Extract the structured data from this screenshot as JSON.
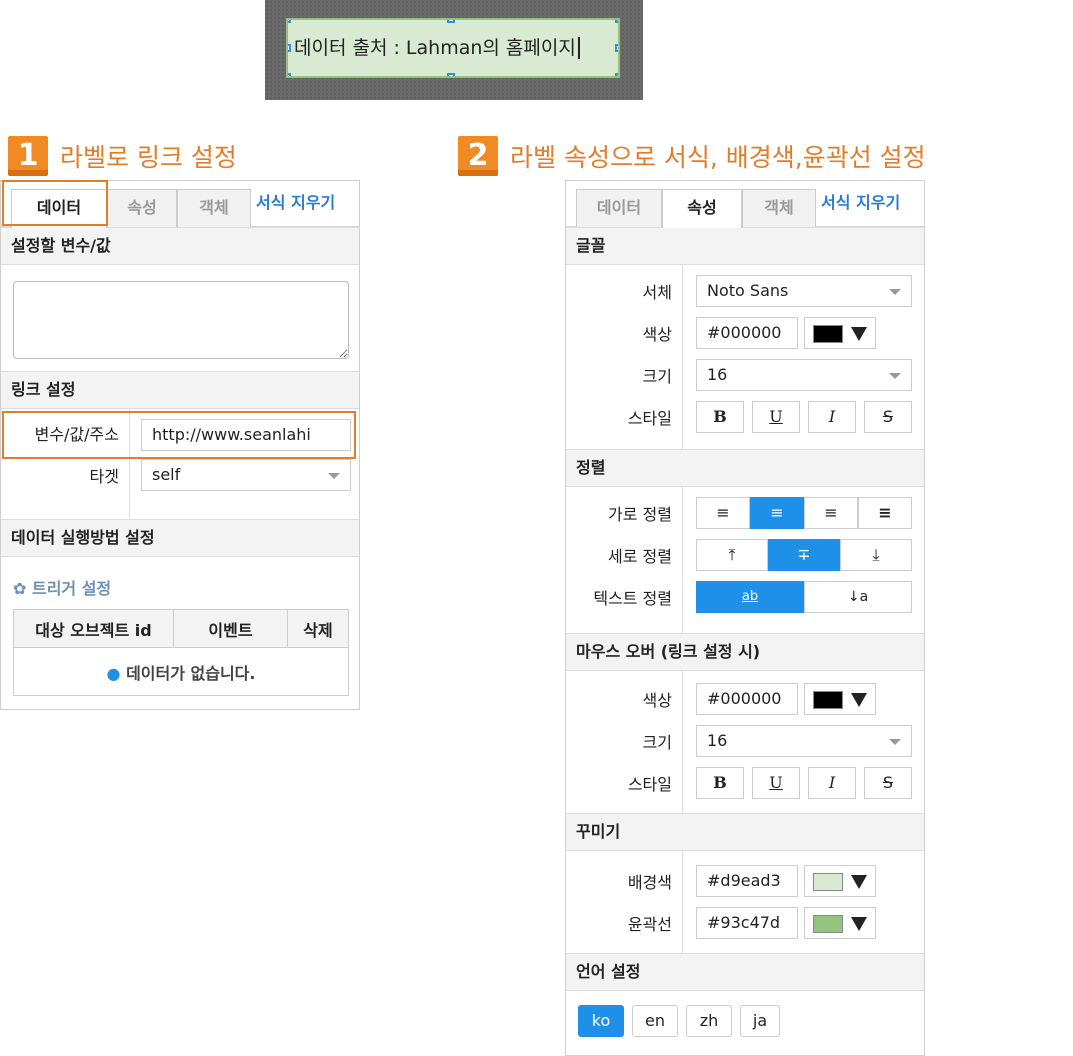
{
  "canvas_label": "데이터 출처 : Lahman의 홈페이지",
  "step1": {
    "num": "1",
    "title": "라벨로 링크 설정"
  },
  "step2": {
    "num": "2",
    "title": "라벨 속성으로 서식, 배경색,윤곽선 설정"
  },
  "tabs": {
    "data": "데이터",
    "props": "속성",
    "object": "객체",
    "clear": "서식 지우기"
  },
  "left": {
    "sec_var": "설정할 변수/값",
    "sec_link": "링크 설정",
    "link_var_label": "변수/값/주소",
    "link_var_value": "http://www.seanlahi",
    "target_label": "타겟",
    "target_value": "self",
    "sec_exec": "데이터 실행방법 설정",
    "trigger": "트리거 설정",
    "table_headers": [
      "대상 오브젝트 id",
      "이벤트",
      "삭제"
    ],
    "empty": "데이터가 없습니다."
  },
  "right": {
    "sec_font": "글꼴",
    "font_label": "서체",
    "font_value": "Noto Sans",
    "color_label": "색상",
    "color_value": "#000000",
    "size_label": "크기",
    "size_value": "16",
    "style_label": "스타일",
    "style_buttons": [
      "B",
      "U",
      "I",
      "S"
    ],
    "sec_align": "정렬",
    "halign_label": "가로 정렬",
    "valign_label": "세로 정렬",
    "talign_label": "텍스트 정렬",
    "halign_icons": [
      "align-left-icon",
      "align-center-icon",
      "align-right-icon",
      "align-justify-icon"
    ],
    "valign_icons": [
      "align-top-icon",
      "align-middle-icon",
      "align-bottom-icon"
    ],
    "talign_icons": [
      "text-horizontal-icon",
      "text-vertical-icon"
    ],
    "halign_glyphs": [
      "≡",
      "≡",
      "≡",
      "≡"
    ],
    "valign_glyphs": [
      "⤒",
      "∓",
      "⤓"
    ],
    "talign_glyphs": [
      "ab",
      "↓a"
    ],
    "sec_hover": "마우스 오버 (링크 설정 시)",
    "hover_color_label": "색상",
    "hover_color_value": "#000000",
    "hover_size_label": "크기",
    "hover_size_value": "16",
    "hover_style_label": "스타일",
    "sec_decor": "꾸미기",
    "bg_label": "배경색",
    "bg_value": "#d9ead3",
    "border_label": "윤곽선",
    "border_value": "#93c47d",
    "sec_lang": "언어 설정",
    "langs": [
      "ko",
      "en",
      "zh",
      "ja"
    ]
  },
  "colors": {
    "bg": "#d9ead3",
    "border": "#93c47d",
    "text": "#000000",
    "accent": "#1e90e8",
    "step": "#e37d2a"
  }
}
